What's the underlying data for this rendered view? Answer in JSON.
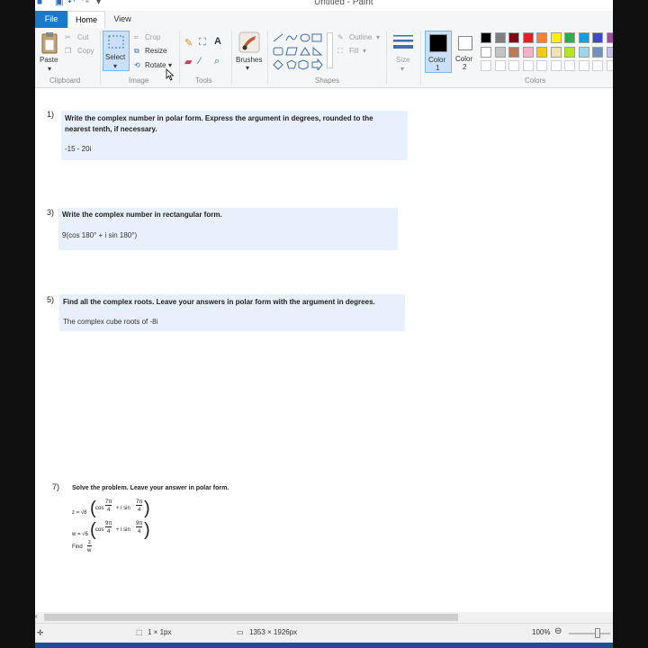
{
  "window": {
    "title": "Untitled - Paint"
  },
  "tabs": {
    "file": "File",
    "home": "Home",
    "view": "View"
  },
  "ribbon": {
    "clipboard": {
      "paste": "Paste",
      "cut": "Cut",
      "copy": "Copy",
      "label": "Clipboard"
    },
    "image": {
      "select": "Select",
      "crop": "Crop",
      "resize": "Resize",
      "rotate": "Rotate",
      "label": "Image"
    },
    "tools": {
      "label": "Tools"
    },
    "brushes": {
      "label": "Brushes"
    },
    "shapes": {
      "outline": "Outline",
      "fill": "Fill",
      "label": "Shapes"
    },
    "size": {
      "label": "Size"
    },
    "colors": {
      "color1": "Color",
      "color1_num": "1",
      "color2": "Color",
      "color2_num": "2",
      "label": "Colors",
      "palette_row1": [
        "#000000",
        "#7f7f7f",
        "#880015",
        "#ed1c24",
        "#ff7f27",
        "#fff200",
        "#22b14c",
        "#00a2e8",
        "#3f48cc",
        "#a349a4"
      ],
      "palette_row2": [
        "#ffffff",
        "#c3c3c3",
        "#b97a57",
        "#ffaec9",
        "#ffc90e",
        "#efe4b0",
        "#b5e61d",
        "#99d9ea",
        "#7092be",
        "#c8bfe7"
      ],
      "color1_value": "#000000",
      "color2_value": "#ffffff"
    }
  },
  "canvas": {
    "q1": {
      "num": "1)",
      "text1": "Write the complex number in polar form. Express the argument in degrees, rounded to the",
      "text2": "nearest tenth, if necessary.",
      "expr": "-15 - 20i"
    },
    "q3": {
      "num": "3)",
      "text": "Write the complex number in rectangular form.",
      "expr": "9(cos 180° + i sin 180°)"
    },
    "q5": {
      "num": "5)",
      "text": "Find all the complex roots. Leave your answers in polar form with the argument in degrees.",
      "expr": "The complex cube roots of -8i"
    },
    "q7": {
      "num": "7)",
      "text": "Solve the problem. Leave your answer in polar form.",
      "z_prefix": "z = √8",
      "z_cos": "cos",
      "z_num1": "7π",
      "z_den1": "4",
      "z_mid": "+ i sin",
      "z_num2": "7π",
      "z_den2": "4",
      "w_prefix": "w = √6",
      "w_cos": "cos",
      "w_num1": "9π",
      "w_den1": "4",
      "w_mid": "+ i sin",
      "w_num2": "9π",
      "w_den2": "4",
      "find": "Find",
      "frac_num": "z",
      "frac_den": "w"
    }
  },
  "statusbar": {
    "pixel": "1 × 1px",
    "dimensions": "1353 × 1926px",
    "zoom": "100%"
  }
}
